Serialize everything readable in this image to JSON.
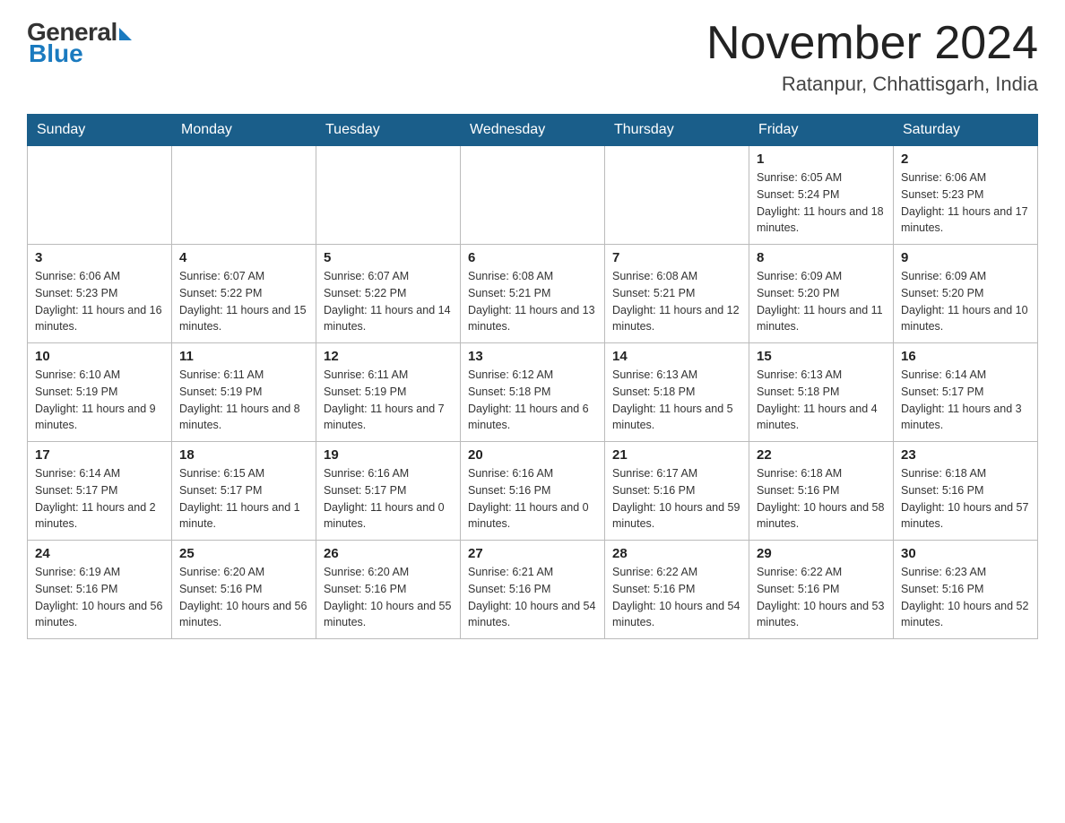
{
  "header": {
    "logo": {
      "general": "General",
      "blue": "Blue"
    },
    "title": "November 2024",
    "location": "Ratanpur, Chhattisgarh, India"
  },
  "weekdays": [
    "Sunday",
    "Monday",
    "Tuesday",
    "Wednesday",
    "Thursday",
    "Friday",
    "Saturday"
  ],
  "weeks": [
    [
      {
        "day": "",
        "sunrise": "",
        "sunset": "",
        "daylight": ""
      },
      {
        "day": "",
        "sunrise": "",
        "sunset": "",
        "daylight": ""
      },
      {
        "day": "",
        "sunrise": "",
        "sunset": "",
        "daylight": ""
      },
      {
        "day": "",
        "sunrise": "",
        "sunset": "",
        "daylight": ""
      },
      {
        "day": "",
        "sunrise": "",
        "sunset": "",
        "daylight": ""
      },
      {
        "day": "1",
        "sunrise": "Sunrise: 6:05 AM",
        "sunset": "Sunset: 5:24 PM",
        "daylight": "Daylight: 11 hours and 18 minutes."
      },
      {
        "day": "2",
        "sunrise": "Sunrise: 6:06 AM",
        "sunset": "Sunset: 5:23 PM",
        "daylight": "Daylight: 11 hours and 17 minutes."
      }
    ],
    [
      {
        "day": "3",
        "sunrise": "Sunrise: 6:06 AM",
        "sunset": "Sunset: 5:23 PM",
        "daylight": "Daylight: 11 hours and 16 minutes."
      },
      {
        "day": "4",
        "sunrise": "Sunrise: 6:07 AM",
        "sunset": "Sunset: 5:22 PM",
        "daylight": "Daylight: 11 hours and 15 minutes."
      },
      {
        "day": "5",
        "sunrise": "Sunrise: 6:07 AM",
        "sunset": "Sunset: 5:22 PM",
        "daylight": "Daylight: 11 hours and 14 minutes."
      },
      {
        "day": "6",
        "sunrise": "Sunrise: 6:08 AM",
        "sunset": "Sunset: 5:21 PM",
        "daylight": "Daylight: 11 hours and 13 minutes."
      },
      {
        "day": "7",
        "sunrise": "Sunrise: 6:08 AM",
        "sunset": "Sunset: 5:21 PM",
        "daylight": "Daylight: 11 hours and 12 minutes."
      },
      {
        "day": "8",
        "sunrise": "Sunrise: 6:09 AM",
        "sunset": "Sunset: 5:20 PM",
        "daylight": "Daylight: 11 hours and 11 minutes."
      },
      {
        "day": "9",
        "sunrise": "Sunrise: 6:09 AM",
        "sunset": "Sunset: 5:20 PM",
        "daylight": "Daylight: 11 hours and 10 minutes."
      }
    ],
    [
      {
        "day": "10",
        "sunrise": "Sunrise: 6:10 AM",
        "sunset": "Sunset: 5:19 PM",
        "daylight": "Daylight: 11 hours and 9 minutes."
      },
      {
        "day": "11",
        "sunrise": "Sunrise: 6:11 AM",
        "sunset": "Sunset: 5:19 PM",
        "daylight": "Daylight: 11 hours and 8 minutes."
      },
      {
        "day": "12",
        "sunrise": "Sunrise: 6:11 AM",
        "sunset": "Sunset: 5:19 PM",
        "daylight": "Daylight: 11 hours and 7 minutes."
      },
      {
        "day": "13",
        "sunrise": "Sunrise: 6:12 AM",
        "sunset": "Sunset: 5:18 PM",
        "daylight": "Daylight: 11 hours and 6 minutes."
      },
      {
        "day": "14",
        "sunrise": "Sunrise: 6:13 AM",
        "sunset": "Sunset: 5:18 PM",
        "daylight": "Daylight: 11 hours and 5 minutes."
      },
      {
        "day": "15",
        "sunrise": "Sunrise: 6:13 AM",
        "sunset": "Sunset: 5:18 PM",
        "daylight": "Daylight: 11 hours and 4 minutes."
      },
      {
        "day": "16",
        "sunrise": "Sunrise: 6:14 AM",
        "sunset": "Sunset: 5:17 PM",
        "daylight": "Daylight: 11 hours and 3 minutes."
      }
    ],
    [
      {
        "day": "17",
        "sunrise": "Sunrise: 6:14 AM",
        "sunset": "Sunset: 5:17 PM",
        "daylight": "Daylight: 11 hours and 2 minutes."
      },
      {
        "day": "18",
        "sunrise": "Sunrise: 6:15 AM",
        "sunset": "Sunset: 5:17 PM",
        "daylight": "Daylight: 11 hours and 1 minute."
      },
      {
        "day": "19",
        "sunrise": "Sunrise: 6:16 AM",
        "sunset": "Sunset: 5:17 PM",
        "daylight": "Daylight: 11 hours and 0 minutes."
      },
      {
        "day": "20",
        "sunrise": "Sunrise: 6:16 AM",
        "sunset": "Sunset: 5:16 PM",
        "daylight": "Daylight: 11 hours and 0 minutes."
      },
      {
        "day": "21",
        "sunrise": "Sunrise: 6:17 AM",
        "sunset": "Sunset: 5:16 PM",
        "daylight": "Daylight: 10 hours and 59 minutes."
      },
      {
        "day": "22",
        "sunrise": "Sunrise: 6:18 AM",
        "sunset": "Sunset: 5:16 PM",
        "daylight": "Daylight: 10 hours and 58 minutes."
      },
      {
        "day": "23",
        "sunrise": "Sunrise: 6:18 AM",
        "sunset": "Sunset: 5:16 PM",
        "daylight": "Daylight: 10 hours and 57 minutes."
      }
    ],
    [
      {
        "day": "24",
        "sunrise": "Sunrise: 6:19 AM",
        "sunset": "Sunset: 5:16 PM",
        "daylight": "Daylight: 10 hours and 56 minutes."
      },
      {
        "day": "25",
        "sunrise": "Sunrise: 6:20 AM",
        "sunset": "Sunset: 5:16 PM",
        "daylight": "Daylight: 10 hours and 56 minutes."
      },
      {
        "day": "26",
        "sunrise": "Sunrise: 6:20 AM",
        "sunset": "Sunset: 5:16 PM",
        "daylight": "Daylight: 10 hours and 55 minutes."
      },
      {
        "day": "27",
        "sunrise": "Sunrise: 6:21 AM",
        "sunset": "Sunset: 5:16 PM",
        "daylight": "Daylight: 10 hours and 54 minutes."
      },
      {
        "day": "28",
        "sunrise": "Sunrise: 6:22 AM",
        "sunset": "Sunset: 5:16 PM",
        "daylight": "Daylight: 10 hours and 54 minutes."
      },
      {
        "day": "29",
        "sunrise": "Sunrise: 6:22 AM",
        "sunset": "Sunset: 5:16 PM",
        "daylight": "Daylight: 10 hours and 53 minutes."
      },
      {
        "day": "30",
        "sunrise": "Sunrise: 6:23 AM",
        "sunset": "Sunset: 5:16 PM",
        "daylight": "Daylight: 10 hours and 52 minutes."
      }
    ]
  ]
}
